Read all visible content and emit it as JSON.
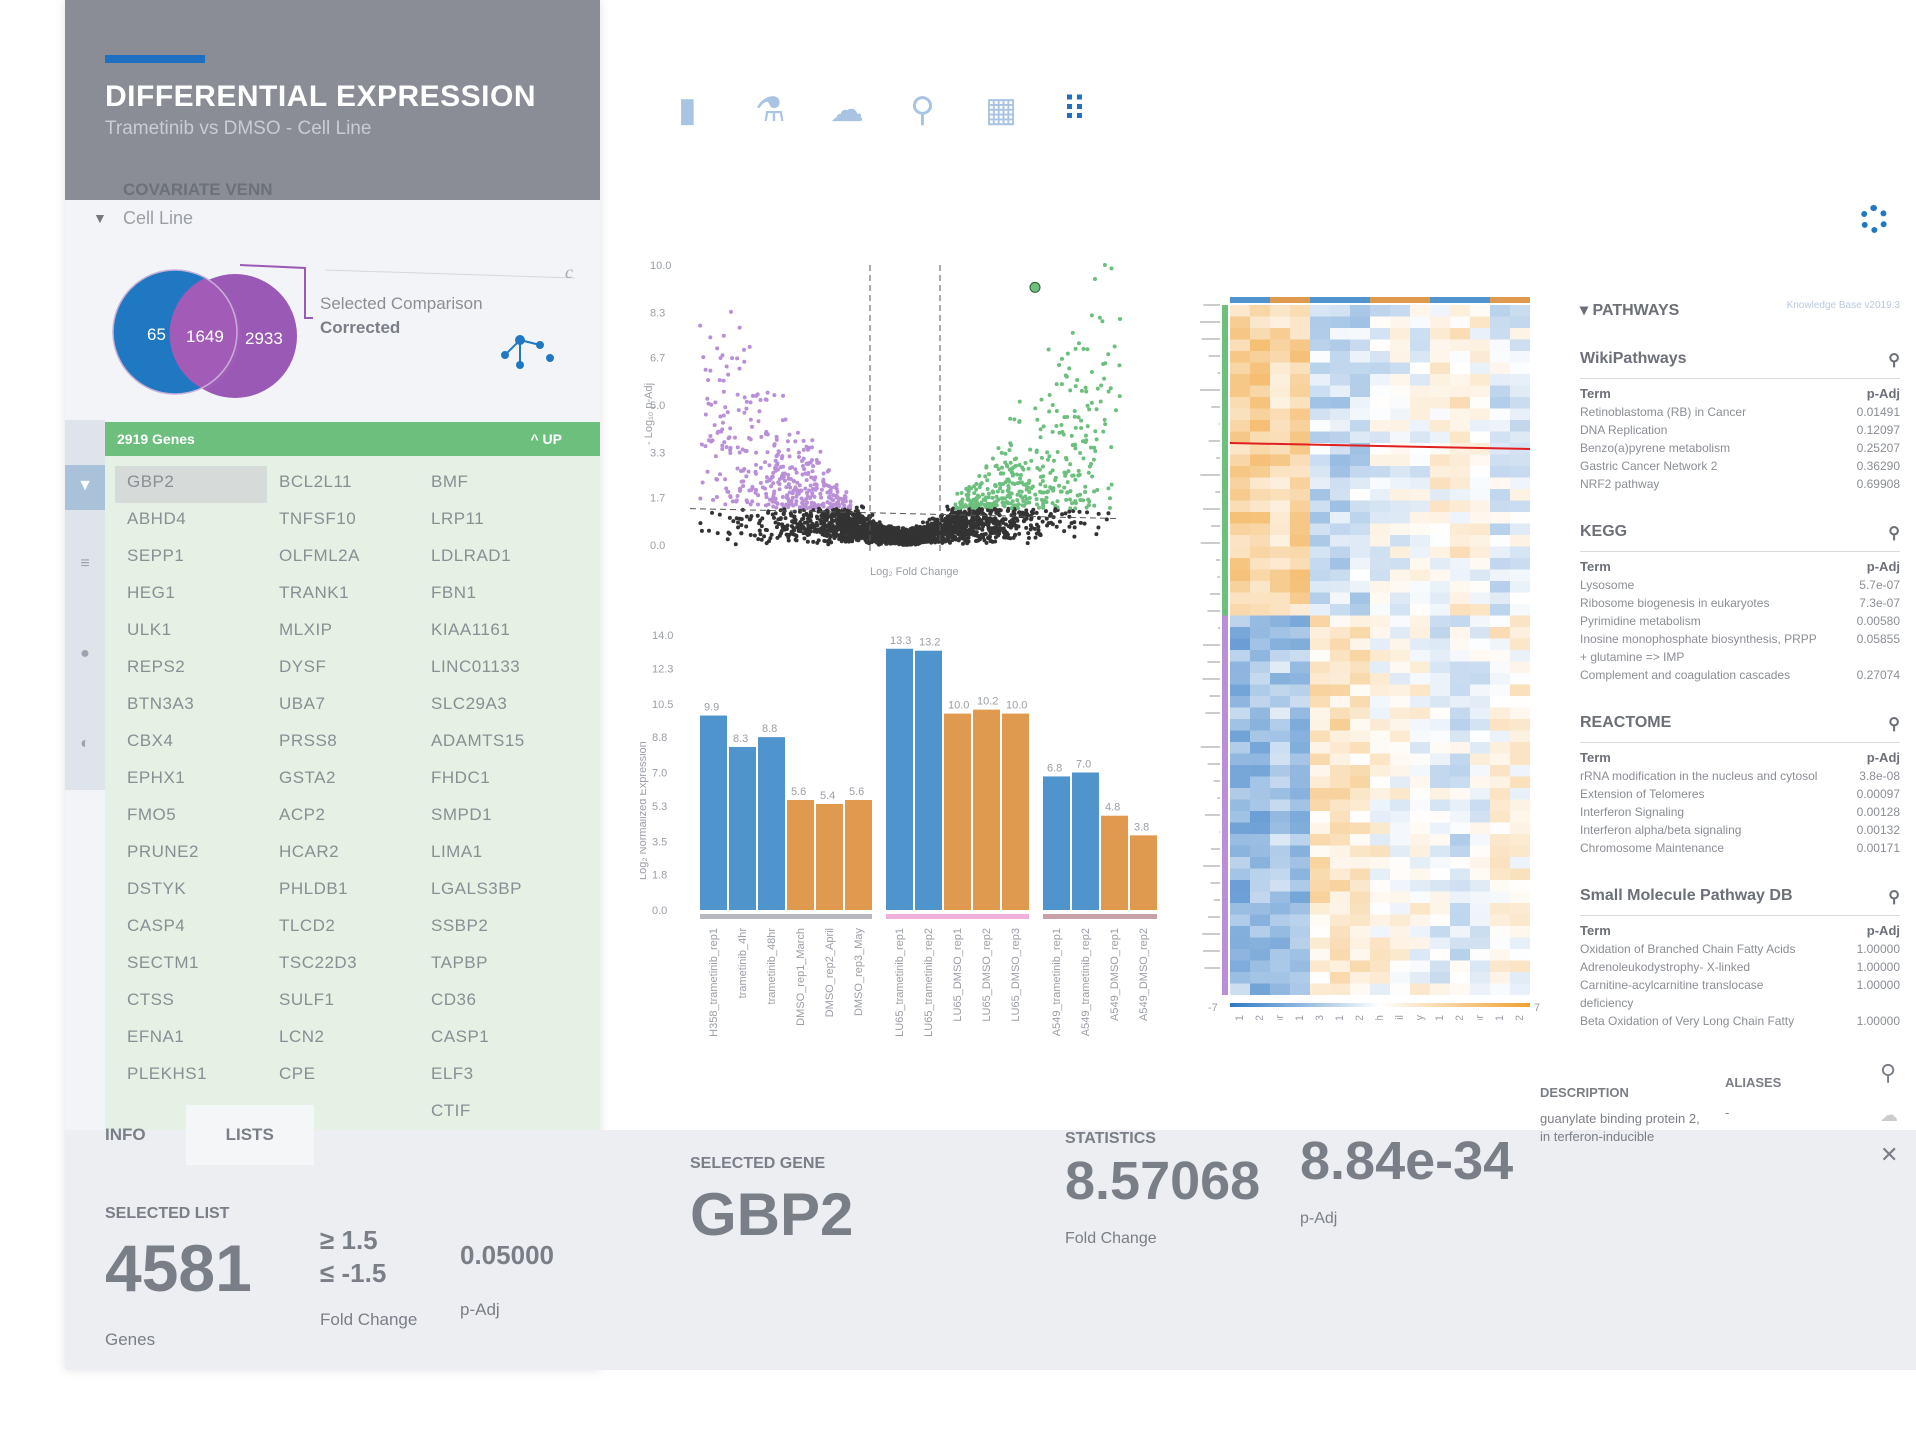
{
  "header": {
    "title": "DIFFERENTIAL EXPRESSION",
    "subtitle": "Trametinib vs DMSO - Cell Line"
  },
  "toolbar": {
    "icons": [
      "document-icon",
      "flask-icon",
      "cloud-download-icon",
      "analytics-search-icon",
      "table-settings-icon",
      "scatter-plot-icon"
    ]
  },
  "venn": {
    "title": "COVARIATE VENN",
    "covariate": "Cell Line",
    "left": "65",
    "overlap": "1649",
    "right": "2933",
    "label1": "Selected Comparison",
    "label2": "Corrected",
    "c_label": "c",
    "colors": {
      "left": "#1f78c1",
      "right": "#9b59b6"
    }
  },
  "genes": {
    "count_label": "2919 Genes",
    "direction": "UP",
    "columns": [
      [
        "GBP2",
        "ABHD4",
        "SEPP1",
        "HEG1",
        "ULK1",
        "REPS2",
        "BTN3A3",
        "CBX4",
        "EPHX1",
        "FMO5",
        "PRUNE2",
        "DSTYK",
        "CASP4",
        "SECTM1",
        "CTSS",
        "EFNA1",
        "PLEKHS1"
      ],
      [
        "BCL2L11",
        "TNFSF10",
        "OLFML2A",
        "TRANK1",
        "MLXIP",
        "DYSF",
        "UBA7",
        "PRSS8",
        "GSTA2",
        "ACP2",
        "HCAR2",
        "PHLDB1",
        "TLCD2",
        "TSC22D3",
        "SULF1",
        "LCN2",
        "CPE"
      ],
      [
        "BMF",
        "LRP11",
        "LDLRAD1",
        "FBN1",
        "KIAA1161",
        "LINC01133",
        "SLC29A3",
        "ADAMTS15",
        "FHDC1",
        "SMPD1",
        "LIMA1",
        "LGALS3BP",
        "SSBP2",
        "TAPBP",
        "CD36",
        "CASP1",
        "ELF3",
        "CTIF"
      ]
    ],
    "selected": "GBP2",
    "color": "#6cbf7d"
  },
  "tabs": [
    "INFO",
    "LISTS"
  ],
  "selected_list": {
    "label": "SELECTED LIST",
    "count": "4581",
    "count_unit": "Genes",
    "fc_up": "≥  1.5",
    "fc_down": "≤ -1.5",
    "fc_label": "Fold Change",
    "padj": "0.05000",
    "padj_label": "p-Adj"
  },
  "selected_gene": {
    "label": "SELECTED GENE",
    "name": "GBP2"
  },
  "statistics": {
    "label": "STATISTICS",
    "fold_change": "8.57068",
    "fold_change_label": "Fold Change",
    "padj": "8.84e-34",
    "padj_label": "p-Adj"
  },
  "description": {
    "label": "DESCRIPTION",
    "text": "guanylate binding protein 2, in terferon-inducible"
  },
  "aliases": {
    "label": "ALIASES",
    "text": "-"
  },
  "pathways": {
    "title": "PATHWAYS",
    "kb": "Knowledge Base v2019.3",
    "term_label": "Term",
    "padj_label": "p-Adj",
    "sections": [
      {
        "name": "WikiPathways",
        "rows": [
          [
            "Retinoblastoma (RB) in Cancer",
            "0.01491"
          ],
          [
            "DNA Replication",
            "0.12097"
          ],
          [
            "Benzo(a)pyrene metabolism",
            "0.25207"
          ],
          [
            "Gastric Cancer Network 2",
            "0.36290"
          ],
          [
            "NRF2 pathway",
            "0.69908"
          ]
        ]
      },
      {
        "name": "KEGG",
        "rows": [
          [
            "Lysosome",
            "5.7e-07"
          ],
          [
            "Ribosome biogenesis in eukaryotes",
            "7.3e-07"
          ],
          [
            "Pyrimidine metabolism",
            "0.00580"
          ],
          [
            "Inosine monophosphate biosynthesis, PRPP + glutamine => IMP",
            "0.05855"
          ],
          [
            "Complement and coagulation cascades",
            "0.27074"
          ]
        ]
      },
      {
        "name": "REACTOME",
        "rows": [
          [
            "rRNA modification in the nucleus and cytosol",
            "3.8e-08"
          ],
          [
            "Extension of Telomeres",
            "0.00097"
          ],
          [
            "Interferon Signaling",
            "0.00128"
          ],
          [
            "Interferon alpha/beta signaling",
            "0.00132"
          ],
          [
            "Chromosome Maintenance",
            "0.00171"
          ]
        ]
      },
      {
        "name": "Small Molecule Pathway DB",
        "rows": [
          [
            "Oxidation of Branched Chain Fatty Acids",
            "1.00000"
          ],
          [
            "Adrenoleukodystrophy- X-linked",
            "1.00000"
          ],
          [
            "Carnitine-acylcarnitine translocase deficiency",
            "1.00000"
          ],
          [
            "Beta Oxidation of Very Long Chain Fatty",
            "1.00000"
          ]
        ]
      }
    ]
  },
  "chart_data": [
    {
      "type": "scatter",
      "name": "volcano",
      "xlabel": "Log₂ Fold Change",
      "ylabel": "- Log₁₀ p-Adj",
      "yticks": [
        "0.0",
        "1.7",
        "3.3",
        "5.0",
        "6.7",
        "8.3",
        "10.0"
      ],
      "ylim": [
        0,
        10
      ],
      "colors": {
        "down": "#b98fd8",
        "up": "#6cbf7d",
        "ns": "#333333"
      }
    },
    {
      "type": "bar",
      "ylabel": "Log₂ Normalized Expression",
      "ylim": [
        0,
        14
      ],
      "yticks": [
        "0.0",
        "1.8",
        "3.5",
        "5.3",
        "7.0",
        "8.8",
        "10.5",
        "12.3",
        "14.0"
      ],
      "categories": [
        "H358_trametinib_rep1",
        "trametinib_4hr",
        "trametinib_48hr",
        "DMSO_rep1_March",
        "DMSO_rep2_April",
        "DMSO_rep3_May",
        "LU65_trametinib_rep1",
        "LU65_trametinib_rep2",
        "LU65_DMSO_rep1",
        "LU65_DMSO_rep2",
        "LU65_DMSO_rep3",
        "A549_trametinib_rep1",
        "A549_trametinib_rep2",
        "A549_DMSO_rep1",
        "A549_DMSO_rep2"
      ],
      "values": [
        9.9,
        8.3,
        8.8,
        5.6,
        5.4,
        5.6,
        13.3,
        13.2,
        10.0,
        10.2,
        10.0,
        6.8,
        7.0,
        4.8,
        3.8
      ],
      "labels": [
        "9.9",
        "8.3",
        "8.8",
        "5.6",
        "5.4",
        "5.6",
        "13.3",
        "13.2",
        "10.0",
        "10.2",
        "10.0",
        "6.8",
        "7.0",
        "4.8",
        "3.8"
      ],
      "treatment": [
        "t",
        "t",
        "t",
        "d",
        "d",
        "d",
        "t",
        "t",
        "d",
        "d",
        "d",
        "t",
        "t",
        "d",
        "d"
      ],
      "groups": [
        6,
        5,
        4
      ],
      "group_colors": [
        "#b8b8c0",
        "#f0b0dc",
        "#c8a0a8"
      ],
      "colors": {
        "t": "#4f94cd",
        "d": "#e09a50"
      }
    },
    {
      "type": "heatmap",
      "scale_min": "-7",
      "scale_max": "7",
      "columns": [
        "LU65_trametinib_rep1",
        "LU65_trametinib_rep2",
        "trametinib_48hr",
        "H358_trametinib_rep1",
        "LU65_DMSO_rep3",
        "LU65_DMSO_rep1",
        "LU65_DMSO_rep2",
        "DMSO_rep1_March",
        "DMSO_rep2_April",
        "DMSO_rep3_May",
        "A549_trametinib_rep1",
        "A549_trametinib_rep2",
        "trametinib_4hr",
        "A549_DMSO_rep1",
        "A549_DMSO_rep2"
      ],
      "colors": {
        "low": "#2f78c4",
        "high": "#f0a030"
      }
    }
  ]
}
